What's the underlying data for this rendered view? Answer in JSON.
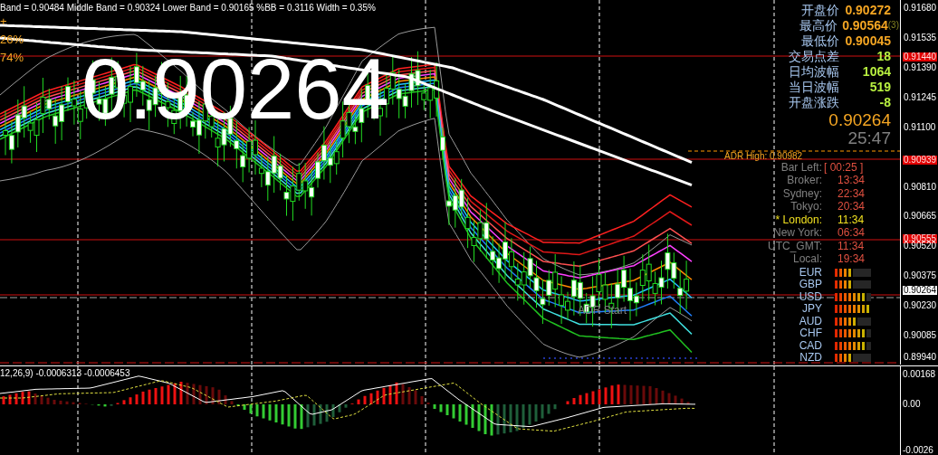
{
  "indicator_header": "Band = 0.90484 Middle Band = 0.90324 Lower Band = 0.90165 %BB = 0.3116 Width = 0.35%",
  "left_labels": [
    "+",
    "26%",
    "74%"
  ],
  "big_price": "0.90264",
  "quote_panel": {
    "rows": [
      {
        "label": "开盘价",
        "value": "0.90272",
        "kind": "price"
      },
      {
        "label": "最高价",
        "value": "0.90564",
        "kind": "price",
        "note": "(3)"
      },
      {
        "label": "最低价",
        "value": "0.90045",
        "kind": "price"
      },
      {
        "label": "交易点差",
        "value": "18",
        "kind": "stat"
      },
      {
        "label": "日均波幅",
        "value": "1064",
        "kind": "stat"
      },
      {
        "label": "当日波幅",
        "value": "519",
        "kind": "stat"
      },
      {
        "label": "开盘涨跌",
        "value": "-8",
        "kind": "stat"
      }
    ],
    "price": "0.90264",
    "countdown": "25:47"
  },
  "adr_high": "ADR High: 0.90982",
  "adr_start": "ADR Start",
  "bar_left": {
    "label": "Bar Left:",
    "value": "[ 00:25 ]"
  },
  "clocks": [
    {
      "label": "Broker:",
      "time": "13:34",
      "active": false
    },
    {
      "label": "Sydney:",
      "time": "22:34",
      "active": false
    },
    {
      "label": "Tokyo:",
      "time": "20:34",
      "active": false
    },
    {
      "label": "* London:",
      "time": "11:34",
      "active": true
    },
    {
      "label": "New York:",
      "time": "06:34",
      "active": false
    },
    {
      "label": "UTC_GMT:",
      "time": "11:34",
      "active": false
    },
    {
      "label": "Local:",
      "time": "19:34",
      "active": false
    }
  ],
  "currency_strength": [
    {
      "code": "EUR",
      "level": 0.5
    },
    {
      "code": "GBP",
      "level": 0.5
    },
    {
      "code": "USD",
      "level": 0.875
    },
    {
      "code": "JPY",
      "level": 1
    },
    {
      "code": "AUD",
      "level": 0.625
    },
    {
      "code": "CHF",
      "level": 0.875
    },
    {
      "code": "CAD",
      "level": 0.875
    },
    {
      "code": "NZD",
      "level": 0.5
    }
  ],
  "price_axis": [
    {
      "value": "0.91680",
      "kind": "tick"
    },
    {
      "value": "0.91535",
      "kind": "tick"
    },
    {
      "value": "0.91440",
      "kind": "marker"
    },
    {
      "value": "0.91390",
      "kind": "tick"
    },
    {
      "value": "0.91245",
      "kind": "tick"
    },
    {
      "value": "0.91100",
      "kind": "tick"
    },
    {
      "value": "0.90939",
      "kind": "marker"
    },
    {
      "value": "0.90810",
      "kind": "tick"
    },
    {
      "value": "0.90665",
      "kind": "tick"
    },
    {
      "value": "0.90555",
      "kind": "marker"
    },
    {
      "value": "0.90520",
      "kind": "tick"
    },
    {
      "value": "0.90375",
      "kind": "tick"
    },
    {
      "value": "0.90264",
      "kind": "current"
    },
    {
      "value": "0.90230",
      "kind": "tick"
    },
    {
      "value": "0.90085",
      "kind": "tick"
    },
    {
      "value": "0.89940",
      "kind": "tick"
    }
  ],
  "macd": {
    "header": "12,26,9) -0.0006313 -0.0006453",
    "axis": [
      "0.00168",
      "0.00",
      "-0.0026"
    ]
  }
}
